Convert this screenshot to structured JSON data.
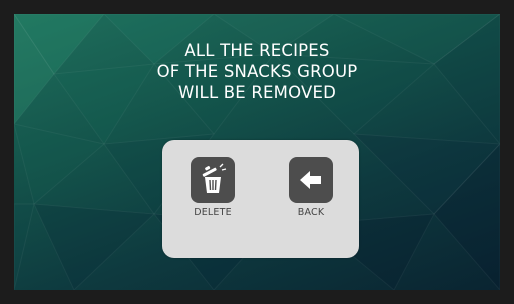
{
  "message": {
    "line1": "ALL THE RECIPES",
    "line2": "OF THE SNACKS GROUP",
    "line3": "WILL BE REMOVED"
  },
  "actions": {
    "delete": {
      "label": "DELETE",
      "icon": "trash-can-icon"
    },
    "back": {
      "label": "BACK",
      "icon": "arrow-left-icon"
    }
  },
  "colors": {
    "background_top": "#1f6f5c",
    "background_bottom": "#0a2431",
    "dialog": "#dcdcdc",
    "button_tile": "#4d4d4d",
    "text": "#ffffff"
  }
}
